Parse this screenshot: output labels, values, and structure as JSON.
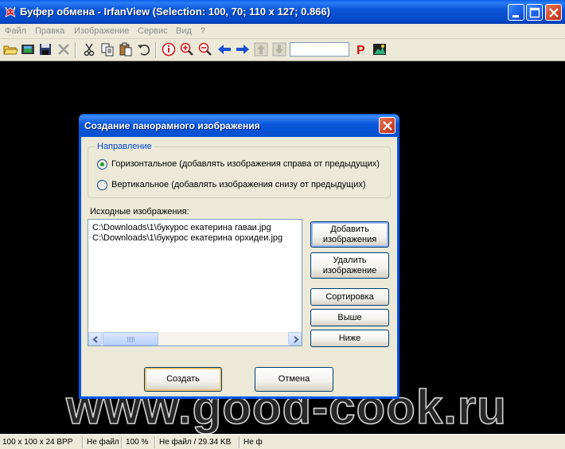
{
  "window": {
    "title": "Буфер обмена - IrfanView (Selection: 100, 70; 110 x 127; 0.866)",
    "icon": "irfanview-cat-icon",
    "controls": [
      "minimize-icon",
      "maximize-icon",
      "close-icon"
    ]
  },
  "menu": {
    "items": [
      "Файл",
      "Правка",
      "Изображение",
      "Сервис",
      "Вид",
      "?"
    ]
  },
  "toolbar": {
    "icons": [
      "open-folder-icon",
      "slideshow-icon",
      "save-icon",
      "delete-icon",
      "cut-icon",
      "copy-icon",
      "paste-icon",
      "undo-icon",
      "info-icon",
      "zoom-in-icon",
      "zoom-out-icon",
      "previous-icon",
      "next-icon",
      "page-up-icon",
      "page-down-icon",
      "print-icon",
      "capture-icon"
    ],
    "page_input_value": ""
  },
  "dialog": {
    "title": "Создание панорамного изображения",
    "direction_group": "Направление",
    "radio_horizontal": "Горизонтальное (добавлять изображения справа от предыдущих)",
    "radio_vertical": "Вертикальное (добавлять изображения снизу от предыдущих)",
    "selected": "horizontal",
    "source_label": "Исходные изображения:",
    "files": [
      "C:\\Downloads\\1\\букурос екатерина гаваи.jpg",
      "C:\\Downloads\\1\\букурос екатерина орхидеи.jpg"
    ],
    "buttons": {
      "add": "Добавить\nизображения",
      "remove": "Удалить\nизображение",
      "sort": "Сортировка",
      "up": "Выше",
      "down": "Ниже",
      "create": "Создать",
      "cancel": "Отмена"
    }
  },
  "status": {
    "dims": "100 x 100 x 24 BPP",
    "file": "Не файл",
    "zoom": "100 %",
    "size": "Не файл / 29.34 KB",
    "extra": "Не ф"
  },
  "watermark": "www.good-cook.ru",
  "colors": {
    "title_blue": "#0a56d8",
    "face": "#ece9d8",
    "canvas": "#000000",
    "group_legend": "#0046d5"
  }
}
